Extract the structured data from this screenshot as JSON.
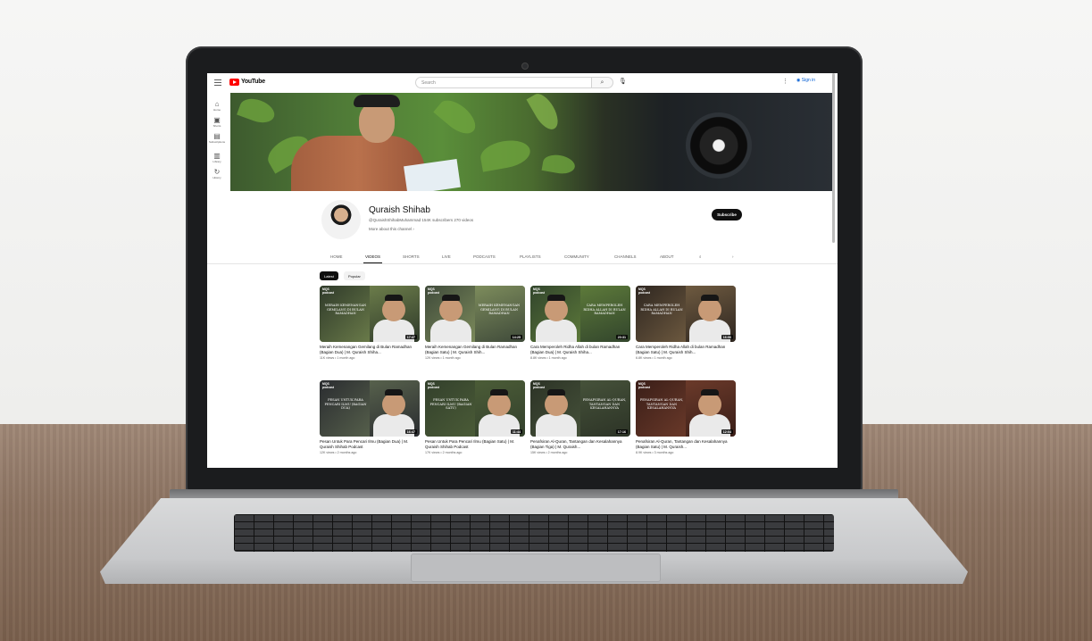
{
  "app": {
    "logo_text": "YouTube",
    "search_placeholder": "Search",
    "signin_label": "Sign in",
    "colors": {
      "brand_red": "#ff0000",
      "link_blue": "#065fd4",
      "text": "#0f0f0f",
      "muted": "#606060"
    }
  },
  "rail": [
    {
      "icon": "home-icon",
      "glyph": "⌂",
      "label": "Home"
    },
    {
      "icon": "shorts-icon",
      "glyph": "▣",
      "label": "Shorts"
    },
    {
      "icon": "subscriptions-icon",
      "glyph": "▤",
      "label": "Subscriptions"
    },
    {
      "icon": "library-icon",
      "glyph": "▥",
      "label": "Library"
    },
    {
      "icon": "history-icon",
      "glyph": "↻",
      "label": "History"
    }
  ],
  "channel": {
    "name": "Quraish Shihab",
    "handle_line": "@QuraishShihabMuhammad 154K subscribers 270 videos",
    "more_label": "More about this channel  ›",
    "subscribe_label": "Subscribe"
  },
  "tabs": [
    "HOME",
    "VIDEOS",
    "SHORTS",
    "LIVE",
    "PODCASTS",
    "PLAYLISTS",
    "COMMUNITY",
    "CHANNELS",
    "ABOUT"
  ],
  "active_tab": "VIDEOS",
  "chips": [
    "Latest",
    "Popular"
  ],
  "videos": [
    {
      "overlay": "Meraih Kemenangan Gemilang di Bulan Ramadhan",
      "duration": "17:47",
      "title": "Meraih Kemenangan Gemilang di Bulan Ramadhan (Bagian Dua) | M. Quraish Shiha...",
      "meta": "11K views • 1 month ago"
    },
    {
      "overlay": "Meraih Kemenangan Gemilang di Bulan Ramadhan",
      "duration": "14:25",
      "title": "Meraih Kemenangan Gemilang di Bulan Ramadhan (Bagian Satu) | M. Quraish Shih...",
      "meta": "12K views • 1 month ago"
    },
    {
      "overlay": "Cara Memperoleh Ridha Allah di Bulan Ramadhan",
      "duration": "20:31",
      "title": "Cara Memperoleh Ridha Allah di bulan Ramadhan (Bagian Dua) | M. Quraish Shiha...",
      "meta": "8.8K views • 1 month ago"
    },
    {
      "overlay": "Cara Memperoleh Ridha Allah di Bulan Ramadhan",
      "duration": "16:06",
      "title": "Cara Memperoleh Ridha Allah di bulan Ramadhan (Bagian Satu) | M. Quraish Shih...",
      "meta": "6.8K views • 1 month ago"
    },
    {
      "overlay": "Pesan Untuk Para Pencari Ilmu (Bagian Dua)",
      "duration": "16:47",
      "title": "Pesan Untuk Para Pencari Ilmu (Bagian Dua) | M. Quraish Shihab Podcast",
      "meta": "12K views • 2 months ago"
    },
    {
      "overlay": "Pesan Untuk Para Pencari Ilmu (Bagian Satu)",
      "duration": "11:44",
      "title": "Pesan Untuk Para Pencari Ilmu (Bagian Satu) | M. Quraish Shihab Podcast",
      "meta": "17K views • 2 months ago"
    },
    {
      "overlay": "Penafsiran Al-Quran, Tantangan dan Kesalahannya",
      "duration": "17:16",
      "title": "Penafsiran Al-Quran, Tantangan dan Kesalahannya (Bagian Tiga) | M. Quraish...",
      "meta": "15K views • 2 months ago"
    },
    {
      "overlay": "Penafsiran Al-Quran, Tantangan dan Kesalahannya",
      "duration": "12:04",
      "title": "Penafsiran Al-Quran, Tantangan dan Kesalahannya (Bagian Satu) | M. Quraish...",
      "meta": "8.9K views • 3 months ago"
    }
  ]
}
